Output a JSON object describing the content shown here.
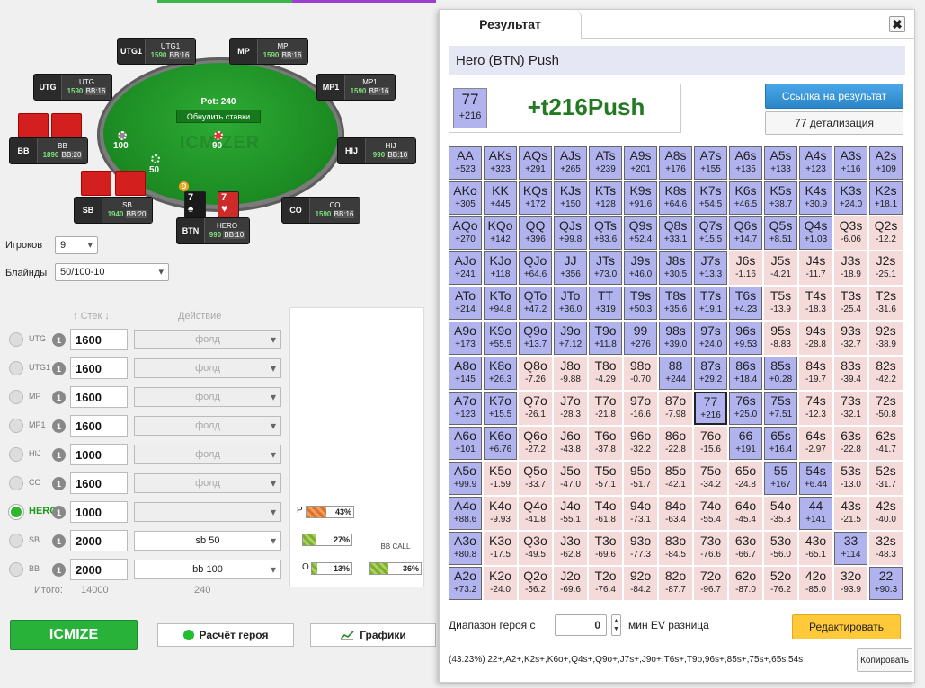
{
  "table": {
    "pot": "Pot: 240",
    "reset_label": "Обнулить ставки",
    "watermark": "ICMIZER",
    "bets": {
      "utg": "100",
      "hero": "90",
      "bb": "50"
    },
    "dealer": "D",
    "seats": {
      "utg1": {
        "pos": "UTG1",
        "name": "UTG1",
        "stack": "1590",
        "bb": "BB:16"
      },
      "mp": {
        "pos": "MP",
        "name": "MP",
        "stack": "1590",
        "bb": "BB:16"
      },
      "utg": {
        "pos": "UTG",
        "name": "UTG",
        "stack": "1590",
        "bb": "BB:16"
      },
      "mp1": {
        "pos": "MP1",
        "name": "MP1",
        "stack": "1590",
        "bb": "BB:16"
      },
      "bb": {
        "pos": "BB",
        "name": "BB",
        "stack": "1890",
        "bb": "BB:20"
      },
      "hij": {
        "pos": "HIJ",
        "name": "HIJ",
        "stack": "990",
        "bb": "BB:10"
      },
      "sb": {
        "pos": "SB",
        "name": "SB",
        "stack": "1940",
        "bb": "BB:20"
      },
      "co": {
        "pos": "CO",
        "name": "CO",
        "stack": "1590",
        "bb": "BB:16"
      },
      "hero": {
        "pos": "BTN",
        "name": "HERO",
        "stack": "990",
        "bb": "BB:10"
      }
    },
    "hero_cards": [
      {
        "rank": "7",
        "suit": "♠"
      },
      {
        "rank": "7",
        "suit": "♥"
      }
    ]
  },
  "settings": {
    "players_label": "Игроков",
    "players_value": "9",
    "blinds_label": "Блайнды",
    "blinds_value": "50/100-10",
    "stack_header": "Стек",
    "action_header": "Действие"
  },
  "players": [
    {
      "name": "UTG",
      "badge": "1",
      "stack": "1600",
      "action": "фолд"
    },
    {
      "name": "UTG1",
      "badge": "1",
      "stack": "1600",
      "action": "фолд"
    },
    {
      "name": "MP",
      "badge": "1",
      "stack": "1600",
      "action": "фолд"
    },
    {
      "name": "MP1",
      "badge": "1",
      "stack": "1600",
      "action": "фолд"
    },
    {
      "name": "HIJ",
      "badge": "1",
      "stack": "1000",
      "action": "фолд"
    },
    {
      "name": "CO",
      "badge": "1",
      "stack": "1600",
      "action": "фолд"
    },
    {
      "name": "HERO",
      "badge": "1",
      "stack": "1000",
      "action": ""
    },
    {
      "name": "SB",
      "badge": "1",
      "stack": "2000",
      "action": "sb 50"
    },
    {
      "name": "BB",
      "badge": "1",
      "stack": "2000",
      "action": "bb 100"
    }
  ],
  "totals": {
    "label": "Итого:",
    "stack": "14000",
    "action": "240"
  },
  "stats": {
    "p_label": "P",
    "p_value": "43%",
    "p_fraction": 0.43,
    "b_value": "27%",
    "b_fraction": 0.27,
    "o_label": "O",
    "o_value": "13%",
    "o_fraction": 0.13,
    "bbcall_label": "BB CALL",
    "bbcall_value": "36%",
    "bbcall_fraction": 0.36
  },
  "buttons": {
    "icmize": "ICMIZE",
    "hero_calc": "Расчёт героя",
    "charts": "Графики"
  },
  "result": {
    "tab": "Результат",
    "close": "✖",
    "title": "Hero (BTN) Push",
    "hand": "77",
    "hand_ev": "+216",
    "big_ev": "+t216Push",
    "link_button": "Ссылка на результат",
    "detail_button": "77 детализация",
    "range_label": "Диапазон героя с",
    "range_value": "0",
    "range_unit": "мин EV разница",
    "edit_button": "Редактировать",
    "range_string": "(43.23%) 22+,A2+,K2s+,K6o+,Q4s+,Q9o+,J7s+,J9o+,T6s+,T9o,96s+,85s+,75s+,65s,54s",
    "copy_button": "Копировать"
  },
  "grid": [
    [
      [
        "AA",
        "+523",
        1
      ],
      [
        "AKs",
        "+323",
        1
      ],
      [
        "AQs",
        "+291",
        1
      ],
      [
        "AJs",
        "+265",
        1
      ],
      [
        "ATs",
        "+239",
        1
      ],
      [
        "A9s",
        "+201",
        1
      ],
      [
        "A8s",
        "+176",
        1
      ],
      [
        "A7s",
        "+155",
        1
      ],
      [
        "A6s",
        "+135",
        1
      ],
      [
        "A5s",
        "+133",
        1
      ],
      [
        "A4s",
        "+123",
        1
      ],
      [
        "A3s",
        "+116",
        1
      ],
      [
        "A2s",
        "+109",
        1
      ]
    ],
    [
      [
        "AKo",
        "+305",
        1
      ],
      [
        "KK",
        "+445",
        1
      ],
      [
        "KQs",
        "+172",
        1
      ],
      [
        "KJs",
        "+150",
        1
      ],
      [
        "KTs",
        "+128",
        1
      ],
      [
        "K9s",
        "+91.6",
        1
      ],
      [
        "K8s",
        "+64.6",
        1
      ],
      [
        "K7s",
        "+54.5",
        1
      ],
      [
        "K6s",
        "+46.5",
        1
      ],
      [
        "K5s",
        "+38.7",
        1
      ],
      [
        "K4s",
        "+30.9",
        1
      ],
      [
        "K3s",
        "+24.0",
        1
      ],
      [
        "K2s",
        "+18.1",
        1
      ]
    ],
    [
      [
        "AQo",
        "+270",
        1
      ],
      [
        "KQo",
        "+142",
        1
      ],
      [
        "QQ",
        "+396",
        1
      ],
      [
        "QJs",
        "+99.8",
        1
      ],
      [
        "QTs",
        "+83.6",
        1
      ],
      [
        "Q9s",
        "+52.4",
        1
      ],
      [
        "Q8s",
        "+33.1",
        1
      ],
      [
        "Q7s",
        "+15.5",
        1
      ],
      [
        "Q6s",
        "+14.7",
        1
      ],
      [
        "Q5s",
        "+8.51",
        1
      ],
      [
        "Q4s",
        "+1.03",
        1
      ],
      [
        "Q3s",
        "-6.06",
        0
      ],
      [
        "Q2s",
        "-12.2",
        0
      ]
    ],
    [
      [
        "AJo",
        "+241",
        1
      ],
      [
        "KJo",
        "+118",
        1
      ],
      [
        "QJo",
        "+64.6",
        1
      ],
      [
        "JJ",
        "+356",
        1
      ],
      [
        "JTs",
        "+73.0",
        1
      ],
      [
        "J9s",
        "+46.0",
        1
      ],
      [
        "J8s",
        "+30.5",
        1
      ],
      [
        "J7s",
        "+13.3",
        1
      ],
      [
        "J6s",
        "-1.16",
        0
      ],
      [
        "J5s",
        "-4.21",
        0
      ],
      [
        "J4s",
        "-11.7",
        0
      ],
      [
        "J3s",
        "-18.9",
        0
      ],
      [
        "J2s",
        "-25.1",
        0
      ]
    ],
    [
      [
        "ATo",
        "+214",
        1
      ],
      [
        "KTo",
        "+94.8",
        1
      ],
      [
        "QTo",
        "+47.2",
        1
      ],
      [
        "JTo",
        "+36.0",
        1
      ],
      [
        "TT",
        "+319",
        1
      ],
      [
        "T9s",
        "+50.3",
        1
      ],
      [
        "T8s",
        "+35.6",
        1
      ],
      [
        "T7s",
        "+19.1",
        1
      ],
      [
        "T6s",
        "+4.23",
        1
      ],
      [
        "T5s",
        "-13.9",
        0
      ],
      [
        "T4s",
        "-18.3",
        0
      ],
      [
        "T3s",
        "-25.4",
        0
      ],
      [
        "T2s",
        "-31.6",
        0
      ]
    ],
    [
      [
        "A9o",
        "+173",
        1
      ],
      [
        "K9o",
        "+55.5",
        1
      ],
      [
        "Q9o",
        "+13.7",
        1
      ],
      [
        "J9o",
        "+7.12",
        1
      ],
      [
        "T9o",
        "+11.8",
        1
      ],
      [
        "99",
        "+276",
        1
      ],
      [
        "98s",
        "+39.0",
        1
      ],
      [
        "97s",
        "+24.0",
        1
      ],
      [
        "96s",
        "+9.53",
        1
      ],
      [
        "95s",
        "-8.83",
        0
      ],
      [
        "94s",
        "-28.8",
        0
      ],
      [
        "93s",
        "-32.7",
        0
      ],
      [
        "92s",
        "-38.9",
        0
      ]
    ],
    [
      [
        "A8o",
        "+145",
        1
      ],
      [
        "K8o",
        "+26.3",
        1
      ],
      [
        "Q8o",
        "-7.26",
        0
      ],
      [
        "J8o",
        "-9.88",
        0
      ],
      [
        "T8o",
        "-4.29",
        0
      ],
      [
        "98o",
        "-0.70",
        0
      ],
      [
        "88",
        "+244",
        1
      ],
      [
        "87s",
        "+29.2",
        1
      ],
      [
        "86s",
        "+18.4",
        1
      ],
      [
        "85s",
        "+0.28",
        1
      ],
      [
        "84s",
        "-19.7",
        0
      ],
      [
        "83s",
        "-39.4",
        0
      ],
      [
        "82s",
        "-42.2",
        0
      ]
    ],
    [
      [
        "A7o",
        "+123",
        1
      ],
      [
        "K7o",
        "+15.5",
        1
      ],
      [
        "Q7o",
        "-26.1",
        0
      ],
      [
        "J7o",
        "-28.3",
        0
      ],
      [
        "T7o",
        "-21.8",
        0
      ],
      [
        "97o",
        "-16.6",
        0
      ],
      [
        "87o",
        "-7.98",
        0
      ],
      [
        "77",
        "+216",
        1
      ],
      [
        "76s",
        "+25.0",
        1
      ],
      [
        "75s",
        "+7.51",
        1
      ],
      [
        "74s",
        "-12.3",
        0
      ],
      [
        "73s",
        "-32.1",
        0
      ],
      [
        "72s",
        "-50.8",
        0
      ]
    ],
    [
      [
        "A6o",
        "+101",
        1
      ],
      [
        "K6o",
        "+6.76",
        1
      ],
      [
        "Q6o",
        "-27.2",
        0
      ],
      [
        "J6o",
        "-43.8",
        0
      ],
      [
        "T6o",
        "-37.8",
        0
      ],
      [
        "96o",
        "-32.2",
        0
      ],
      [
        "86o",
        "-22.8",
        0
      ],
      [
        "76o",
        "-15.6",
        0
      ],
      [
        "66",
        "+191",
        1
      ],
      [
        "65s",
        "+16.4",
        1
      ],
      [
        "64s",
        "-2.97",
        0
      ],
      [
        "63s",
        "-22.8",
        0
      ],
      [
        "62s",
        "-41.7",
        0
      ]
    ],
    [
      [
        "A5o",
        "+99.9",
        1
      ],
      [
        "K5o",
        "-1.59",
        0
      ],
      [
        "Q5o",
        "-33.7",
        0
      ],
      [
        "J5o",
        "-47.0",
        0
      ],
      [
        "T5o",
        "-57.1",
        0
      ],
      [
        "95o",
        "-51.7",
        0
      ],
      [
        "85o",
        "-42.1",
        0
      ],
      [
        "75o",
        "-34.2",
        0
      ],
      [
        "65o",
        "-24.8",
        0
      ],
      [
        "55",
        "+167",
        1
      ],
      [
        "54s",
        "+6.44",
        1
      ],
      [
        "53s",
        "-13.0",
        0
      ],
      [
        "52s",
        "-31.7",
        0
      ]
    ],
    [
      [
        "A4o",
        "+88.6",
        1
      ],
      [
        "K4o",
        "-9.93",
        0
      ],
      [
        "Q4o",
        "-41.8",
        0
      ],
      [
        "J4o",
        "-55.1",
        0
      ],
      [
        "T4o",
        "-61.8",
        0
      ],
      [
        "94o",
        "-73.1",
        0
      ],
      [
        "84o",
        "-63.4",
        0
      ],
      [
        "74o",
        "-55.4",
        0
      ],
      [
        "64o",
        "-45.4",
        0
      ],
      [
        "54o",
        "-35.3",
        0
      ],
      [
        "44",
        "+141",
        1
      ],
      [
        "43s",
        "-21.5",
        0
      ],
      [
        "42s",
        "-40.0",
        0
      ]
    ],
    [
      [
        "A3o",
        "+80.8",
        1
      ],
      [
        "K3o",
        "-17.5",
        0
      ],
      [
        "Q3o",
        "-49.5",
        0
      ],
      [
        "J3o",
        "-62.8",
        0
      ],
      [
        "T3o",
        "-69.6",
        0
      ],
      [
        "93o",
        "-77.3",
        0
      ],
      [
        "83o",
        "-84.5",
        0
      ],
      [
        "73o",
        "-76.6",
        0
      ],
      [
        "63o",
        "-66.7",
        0
      ],
      [
        "53o",
        "-56.0",
        0
      ],
      [
        "43o",
        "-65.1",
        0
      ],
      [
        "33",
        "+114",
        1
      ],
      [
        "32s",
        "-48.3",
        0
      ]
    ],
    [
      [
        "A2o",
        "+73.2",
        1
      ],
      [
        "K2o",
        "-24.0",
        0
      ],
      [
        "Q2o",
        "-56.2",
        0
      ],
      [
        "J2o",
        "-69.6",
        0
      ],
      [
        "T2o",
        "-76.4",
        0
      ],
      [
        "92o",
        "-84.2",
        0
      ],
      [
        "82o",
        "-87.7",
        0
      ],
      [
        "72o",
        "-96.7",
        0
      ],
      [
        "62o",
        "-87.0",
        0
      ],
      [
        "52o",
        "-76.2",
        0
      ],
      [
        "42o",
        "-85.0",
        0
      ],
      [
        "32o",
        "-93.9",
        0
      ],
      [
        "22",
        "+90.3",
        1
      ]
    ]
  ],
  "selected_hand": "77",
  "colors": {
    "in_range": "#b0b3ee",
    "out_range": "#f5dada",
    "ev_positive": "#237a23",
    "icmize": "#28b23a",
    "link": "#2a86c8",
    "edit": "#ffc93a"
  }
}
